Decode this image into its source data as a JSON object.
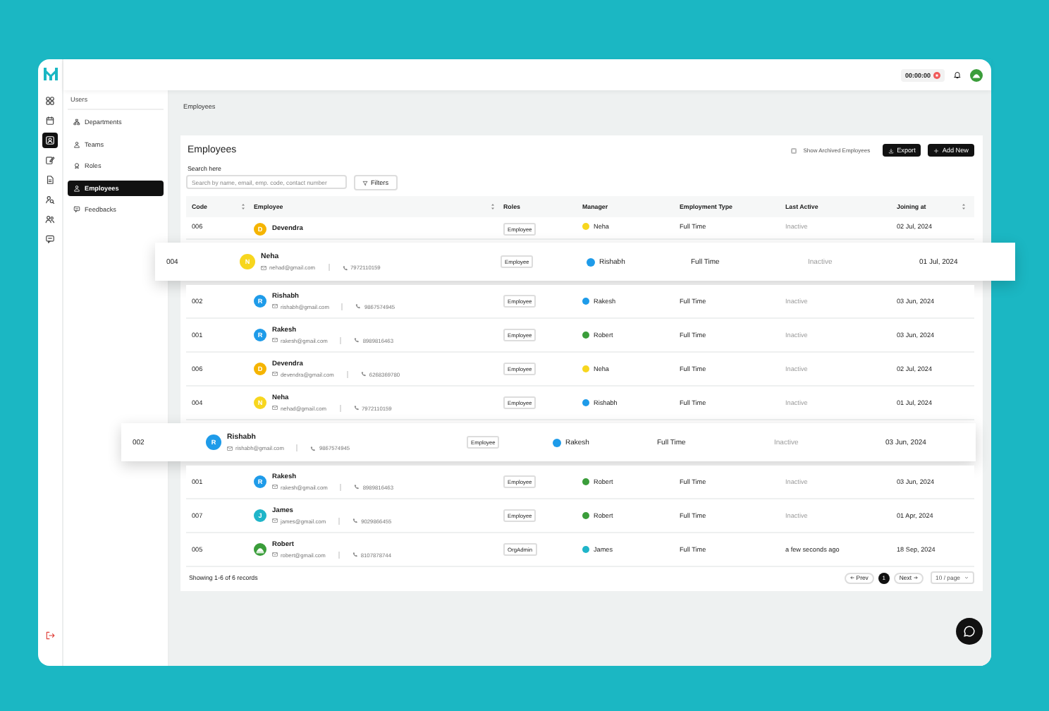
{
  "rail": [
    {
      "selected": false
    },
    {
      "selected": false
    },
    {
      "selected": true
    },
    {
      "selected": false
    },
    {
      "selected": false
    },
    {
      "selected": false
    },
    {
      "selected": false
    },
    {
      "selected": false
    }
  ],
  "topbar": {
    "timer": "00:00:00"
  },
  "sidebar": {
    "title": "Users",
    "items": [
      {
        "label": "Departments",
        "selected": false
      },
      {
        "label": "Teams",
        "selected": false
      },
      {
        "label": "Roles",
        "selected": false
      },
      {
        "label": "Employees",
        "selected": true
      },
      {
        "label": "Feedbacks",
        "selected": false
      }
    ]
  },
  "breadcrumb": "Employees",
  "page": {
    "title": "Employees",
    "show_archived": {
      "label": "Show Archived Employees",
      "checked": false
    },
    "buttons": [
      {
        "label": "Export",
        "kind": "export"
      },
      {
        "label": "Add New",
        "kind": "add"
      }
    ],
    "search": {
      "label": "Search here",
      "placeholder": "Search by name, email, emp. code, contact number"
    },
    "filters": "Filters"
  },
  "table": {
    "columns": [
      {
        "label": "Code",
        "sortable": true
      },
      {
        "label": "Employee",
        "sortable": true
      },
      {
        "label": "Roles",
        "sortable": false
      },
      {
        "label": "Manager",
        "sortable": false
      },
      {
        "label": "Employment Type",
        "sortable": false
      },
      {
        "label": "Last Active",
        "sortable": false
      },
      {
        "label": "Joining at",
        "sortable": true
      }
    ],
    "rows": [
      {
        "code": "006",
        "highlighted": false,
        "employee": {
          "name": "Devendra",
          "initial": "D",
          "color": "#f5b400"
        },
        "role": "Employee",
        "manager": {
          "name": "Neha",
          "color": "#f7d61e"
        },
        "employment_type": "Full Time",
        "last_active": "Inactive",
        "inactive": true,
        "joining": "02 Jul, 2024"
      },
      {
        "code": "004",
        "highlighted": true,
        "employee": {
          "name": "Neha",
          "initial": "N",
          "color": "#f7d61e",
          "email": "nehad@gmail.com",
          "phone": "7972110159"
        },
        "role": "Employee",
        "manager": {
          "name": "Rishabh",
          "color": "#1e9be9"
        },
        "employment_type": "Full Time",
        "last_active": "Inactive",
        "inactive": true,
        "joining": "01 Jul, 2024"
      },
      {
        "code": "002",
        "highlighted": false,
        "employee": {
          "name": "Rishabh",
          "initial": "R",
          "color": "#1e9be9",
          "email": "rishabh@gmail.com",
          "phone": "9867574945"
        },
        "role": "Employee",
        "manager": {
          "name": "Rakesh",
          "color": "#1e9be9"
        },
        "employment_type": "Full Time",
        "last_active": "Inactive",
        "inactive": true,
        "joining": "03 Jun, 2024"
      },
      {
        "code": "001",
        "highlighted": false,
        "employee": {
          "name": "Rakesh",
          "initial": "R",
          "color": "#1e9be9",
          "email": "rakesh@gmail.com",
          "phone": "8989816463"
        },
        "role": "Employee",
        "manager": {
          "name": "Robert",
          "color": "#3a9d3a"
        },
        "employment_type": "Full Time",
        "last_active": "Inactive",
        "inactive": true,
        "joining": "03 Jun, 2024"
      },
      {
        "code": "006",
        "highlighted": false,
        "employee": {
          "name": "Devendra",
          "initial": "D",
          "color": "#f5b400",
          "email": "devendra@gmail.com",
          "phone": "6268369780"
        },
        "role": "Employee",
        "manager": {
          "name": "Neha",
          "color": "#f7d61e"
        },
        "employment_type": "Full Time",
        "last_active": "Inactive",
        "inactive": true,
        "joining": "02 Jul, 2024"
      },
      {
        "code": "004",
        "highlighted": false,
        "employee": {
          "name": "Neha",
          "initial": "N",
          "color": "#f7d61e",
          "email": "nehad@gmail.com",
          "phone": "7972110159"
        },
        "role": "Employee",
        "manager": {
          "name": "Rishabh",
          "color": "#1e9be9"
        },
        "employment_type": "Full Time",
        "last_active": "Inactive",
        "inactive": true,
        "joining": "01 Jul, 2024"
      },
      {
        "code": "002",
        "highlighted": true,
        "employee": {
          "name": "Rishabh",
          "initial": "R",
          "color": "#1e9be9",
          "email": "rishabh@gmail.com",
          "phone": "9867574945"
        },
        "role": "Employee",
        "manager": {
          "name": "Rakesh",
          "color": "#1e9be9"
        },
        "employment_type": "Full Time",
        "last_active": "Inactive",
        "inactive": true,
        "joining": "03 Jun, 2024"
      },
      {
        "code": "001",
        "highlighted": false,
        "employee": {
          "name": "Rakesh",
          "initial": "R",
          "color": "#1e9be9",
          "email": "rakesh@gmail.com",
          "phone": "8989816463"
        },
        "role": "Employee",
        "manager": {
          "name": "Robert",
          "color": "#3a9d3a"
        },
        "employment_type": "Full Time",
        "last_active": "Inactive",
        "inactive": true,
        "joining": "03 Jun, 2024"
      },
      {
        "code": "007",
        "highlighted": false,
        "employee": {
          "name": "James",
          "initial": "J",
          "color": "#1fb5c9",
          "email": "james@gmail.com",
          "phone": "9029866455"
        },
        "role": "Employee",
        "manager": {
          "name": "Robert",
          "color": "#3a9d3a"
        },
        "employment_type": "Full Time",
        "last_active": "Inactive",
        "inactive": true,
        "joining": "01 Apr, 2024"
      },
      {
        "code": "005",
        "highlighted": false,
        "employee": {
          "name": "Robert",
          "kind": "picture",
          "color": "#3a9d3a",
          "email": "robert@gmail.com",
          "phone": "8107878744"
        },
        "role": "OrgAdmin",
        "manager": {
          "name": "James",
          "color": "#1fb5c9"
        },
        "employment_type": "Full Time",
        "last_active": "a few seconds ago",
        "inactive": false,
        "joining": "18 Sep, 2024"
      }
    ]
  },
  "footer": {
    "summary": "Showing 1-6 of 6 records",
    "prev": "Prev",
    "pages": [
      {
        "label": "1",
        "selected": true
      }
    ],
    "next": "Next",
    "page_size": "10 / page"
  }
}
